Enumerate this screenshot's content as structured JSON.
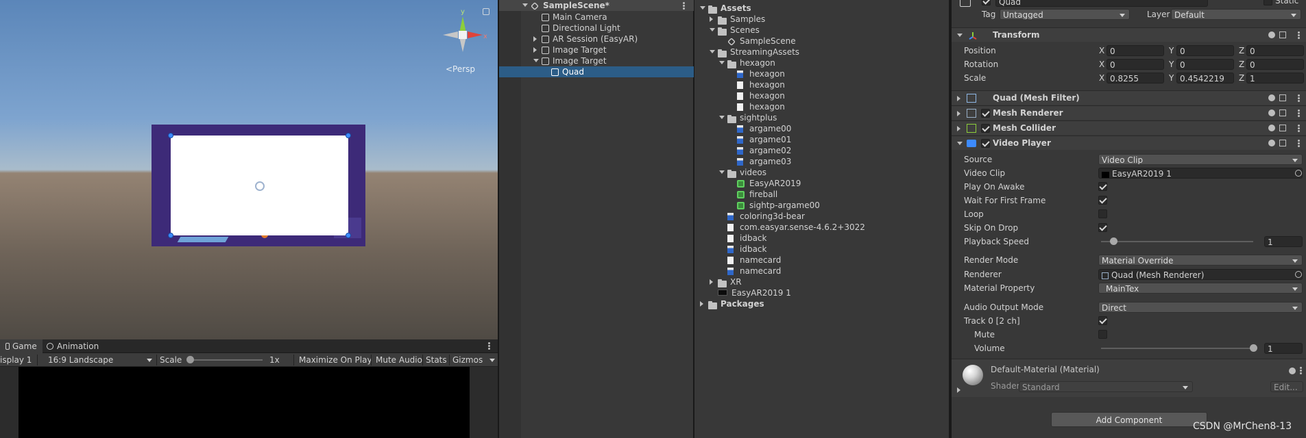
{
  "scene_view": {
    "persp_label": "<Persp",
    "gizmo_axes": {
      "y": "y",
      "x": "x"
    }
  },
  "game_view": {
    "tabs": [
      {
        "label": "Game"
      },
      {
        "label": "Animation"
      }
    ],
    "toolbar": {
      "display": "isplay 1",
      "aspect": "16:9 Landscape",
      "scale_label": "Scale",
      "scale_value": "1x",
      "maximize": "Maximize On Play",
      "mute": "Mute Audio",
      "stats": "Stats",
      "gizmos": "Gizmos"
    }
  },
  "hierarchy": {
    "scene": "SampleScene*",
    "items": [
      {
        "label": "Main Camera"
      },
      {
        "label": "Directional Light"
      },
      {
        "label": "AR Session (EasyAR)"
      },
      {
        "label": "Image Target"
      },
      {
        "label": "Image Target"
      },
      {
        "label": "Quad"
      }
    ]
  },
  "project": {
    "items": [
      {
        "label": "Assets"
      },
      {
        "label": "Samples"
      },
      {
        "label": "Scenes"
      },
      {
        "label": "SampleScene"
      },
      {
        "label": "StreamingAssets"
      },
      {
        "label": "hexagon"
      },
      {
        "label": "hexagon"
      },
      {
        "label": "hexagon"
      },
      {
        "label": "hexagon"
      },
      {
        "label": "hexagon"
      },
      {
        "label": "sightplus"
      },
      {
        "label": "argame00"
      },
      {
        "label": "argame01"
      },
      {
        "label": "argame02"
      },
      {
        "label": "argame03"
      },
      {
        "label": "videos"
      },
      {
        "label": "EasyAR2019"
      },
      {
        "label": "fireball"
      },
      {
        "label": "sightp-argame00"
      },
      {
        "label": "coloring3d-bear"
      },
      {
        "label": "com.easyar.sense-4.6.2+3022"
      },
      {
        "label": "idback"
      },
      {
        "label": "idback"
      },
      {
        "label": "namecard"
      },
      {
        "label": "namecard"
      },
      {
        "label": "XR"
      },
      {
        "label": "EasyAR2019 1"
      },
      {
        "label": "Packages"
      }
    ]
  },
  "inspector": {
    "object_name": "Quad",
    "static_label": "Static",
    "tag_label": "Tag",
    "tag_value": "Untagged",
    "layer_label": "Layer",
    "layer_value": "Default",
    "transform": {
      "title": "Transform",
      "position": {
        "label": "Position",
        "x": "0",
        "y": "0",
        "z": "0"
      },
      "rotation": {
        "label": "Rotation",
        "x": "0",
        "y": "0",
        "z": "0"
      },
      "scale": {
        "label": "Scale",
        "x": "0.8255",
        "y": "0.4542219",
        "z": "1"
      }
    },
    "components": {
      "mesh_filter": "Quad (Mesh Filter)",
      "mesh_renderer": "Mesh Renderer",
      "mesh_collider": "Mesh Collider",
      "video_player": "Video Player"
    },
    "video_player": {
      "source": {
        "label": "Source",
        "value": "Video Clip"
      },
      "video_clip": {
        "label": "Video Clip",
        "value": "EasyAR2019 1"
      },
      "play_on_awake": {
        "label": "Play On Awake",
        "checked": true
      },
      "wait_first_frame": {
        "label": "Wait For First Frame",
        "checked": true
      },
      "loop": {
        "label": "Loop",
        "checked": false
      },
      "skip_on_drop": {
        "label": "Skip On Drop",
        "checked": true
      },
      "playback_speed": {
        "label": "Playback Speed",
        "value": "1",
        "slider_fraction": 0.08
      },
      "render_mode": {
        "label": "Render Mode",
        "value": "Material Override"
      },
      "renderer": {
        "label": "Renderer",
        "value": "Quad (Mesh Renderer)"
      },
      "material_property": {
        "label": "Material Property",
        "value": "_MainTex"
      },
      "audio_output_mode": {
        "label": "Audio Output Mode",
        "value": "Direct"
      },
      "track0": {
        "label": "Track 0 [2 ch]",
        "checked": true
      },
      "mute": {
        "label": "Mute",
        "checked": false
      },
      "volume": {
        "label": "Volume",
        "value": "1",
        "slider_fraction": 1.0
      }
    },
    "material": {
      "title": "Default-Material (Material)",
      "shader_label": "Shader",
      "shader_value": "Standard",
      "edit": "Edit..."
    },
    "add_component": "Add Component"
  },
  "watermark": "CSDN @MrChen8-13",
  "colors": {
    "selection": "#2c5d87",
    "panel": "#383838",
    "accent_x": "#e0433a",
    "accent_y": "#8dcf3a"
  }
}
